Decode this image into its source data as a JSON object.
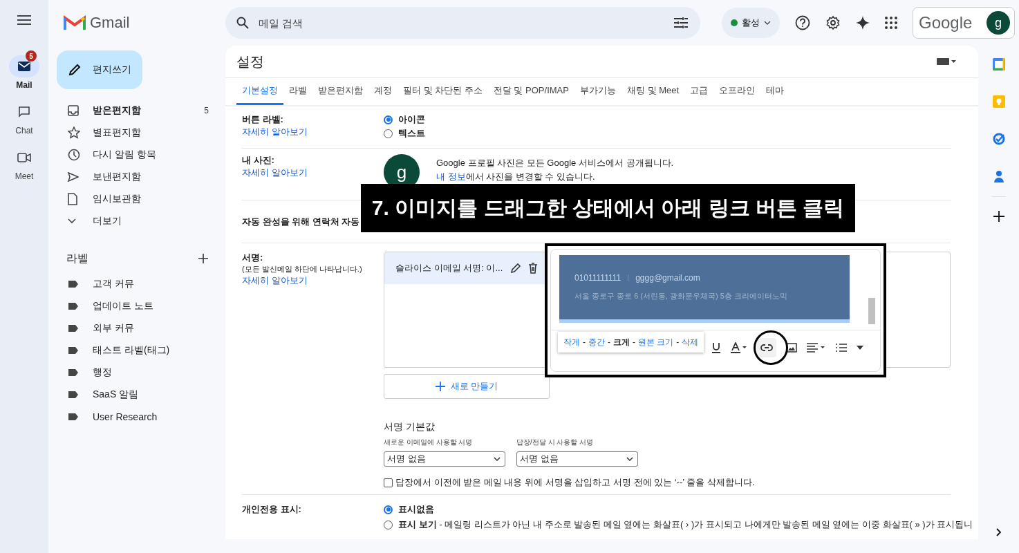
{
  "app": {
    "logo": "Gmail"
  },
  "rail": [
    {
      "label": "Mail",
      "selected": true,
      "badge": "5",
      "kind": "mail"
    },
    {
      "label": "Chat",
      "selected": false,
      "kind": "chat"
    },
    {
      "label": "Meet",
      "selected": false,
      "kind": "meet"
    }
  ],
  "compose": "편지쓰기",
  "folders": [
    {
      "label": "받은편지함",
      "count": "5",
      "unread": true,
      "kind": "inbox"
    },
    {
      "label": "별표편지함",
      "unread": false,
      "kind": "star"
    },
    {
      "label": "다시 알림 항목",
      "unread": false,
      "kind": "clock"
    },
    {
      "label": "보낸편지함",
      "unread": false,
      "kind": "send"
    },
    {
      "label": "임시보관함",
      "unread": false,
      "kind": "file"
    },
    {
      "label": "더보기",
      "unread": false,
      "kind": "more"
    }
  ],
  "labels_heading": "라벨",
  "labels": [
    "고객 커뮤",
    "업데이트 노트",
    "외부 커뮤",
    "태스트 라벨(태그)",
    "행정",
    "SaaS 알림",
    "User Research"
  ],
  "search": {
    "placeholder": "메일 검색"
  },
  "status": {
    "label": "활성",
    "color": "#1e8e3e"
  },
  "account": {
    "logo": "Google",
    "avatar": "g"
  },
  "settings": {
    "title": "설정",
    "tabs": [
      {
        "label": "기본설정",
        "selected": true
      },
      {
        "label": "라벨",
        "selected": false
      },
      {
        "label": "받은편지함",
        "selected": false
      },
      {
        "label": "계정",
        "selected": false
      },
      {
        "label": "필터 및 차단된 주소",
        "selected": false
      },
      {
        "label": "전달 및 POP/IMAP",
        "selected": false
      },
      {
        "label": "부가기능",
        "selected": false
      },
      {
        "label": "채팅 및 Meet",
        "selected": false
      },
      {
        "label": "고급",
        "selected": false
      },
      {
        "label": "오프라인",
        "selected": false
      },
      {
        "label": "테마",
        "selected": false
      }
    ]
  },
  "button_labels": {
    "label": "버튼 라벨:",
    "link": "자세히 알아보기",
    "options": [
      {
        "label": "아이콘",
        "selected": true
      },
      {
        "label": "텍스트",
        "selected": false
      }
    ]
  },
  "photo": {
    "label": "내 사진:",
    "link": "자세히 알아보기",
    "avatar": "g",
    "text": "Google 프로필 사진은 모든 Google 서비스에서 공개됩니다.",
    "note_link": "내 정보",
    "note": "에서 사진을 변경할 수 있습니다."
  },
  "autocomplete": {
    "label": "자동 완성을 위해 연락처 자동"
  },
  "signature": {
    "label": "서명:",
    "hint": "(모든 발신메일 하단에 나타납니다.)",
    "link": "자세히 알아보기",
    "items": [
      {
        "name": "슬라이스 이메일 서명: 이...",
        "selected": true
      }
    ],
    "new_button": "새로 만들기",
    "banner": {
      "phone": "01011111111",
      "email": "gggg@gmail.com",
      "address": "서울 종로구 종로 6 (서린동, 광화문우체국) 5층 크리에이터노믹"
    },
    "size_menu": [
      {
        "kind": "option",
        "label": "작게",
        "selected": false
      },
      {
        "kind": "sep",
        "label": "-"
      },
      {
        "kind": "option",
        "label": "중간",
        "selected": false
      },
      {
        "kind": "sep",
        "label": "-"
      },
      {
        "kind": "option",
        "label": "크게",
        "selected": true
      },
      {
        "kind": "sep",
        "label": "-"
      },
      {
        "kind": "option",
        "label": "원본 크기",
        "selected": false
      },
      {
        "kind": "sep",
        "label": "-"
      },
      {
        "kind": "option",
        "label": "삭제",
        "selected": false
      }
    ],
    "defaults": {
      "title": "서명 기본값",
      "new_label": "새로운 이메일에 사용할 서명",
      "new_value": "서명 없음",
      "reply_label": "답장/전달 시 사용할 서명",
      "reply_value": "서명 없음"
    },
    "insert_option": {
      "label": "답장에서 이전에 받은 메일 내용 위에 서명을 삽입하고 서명 전에 있는 ‘--’ 줄을 삭제합니다.",
      "checked": false
    }
  },
  "personal": {
    "label": "개인전용 표시:",
    "options": [
      {
        "label": "표시없음",
        "selected": true
      },
      {
        "label": "**표시 보기** - 메일링 리스트가 아닌 내 주소로 발송된 메일 옆에는 화살표( › )가 표시되고 나에게만 발송된 메일 옆에는 이중 화살표( » )가 표시됩니",
        "selected": false
      }
    ]
  },
  "caption": "7. 이미지를 드래그한 상태에서 아래 링크 버튼 클릭"
}
